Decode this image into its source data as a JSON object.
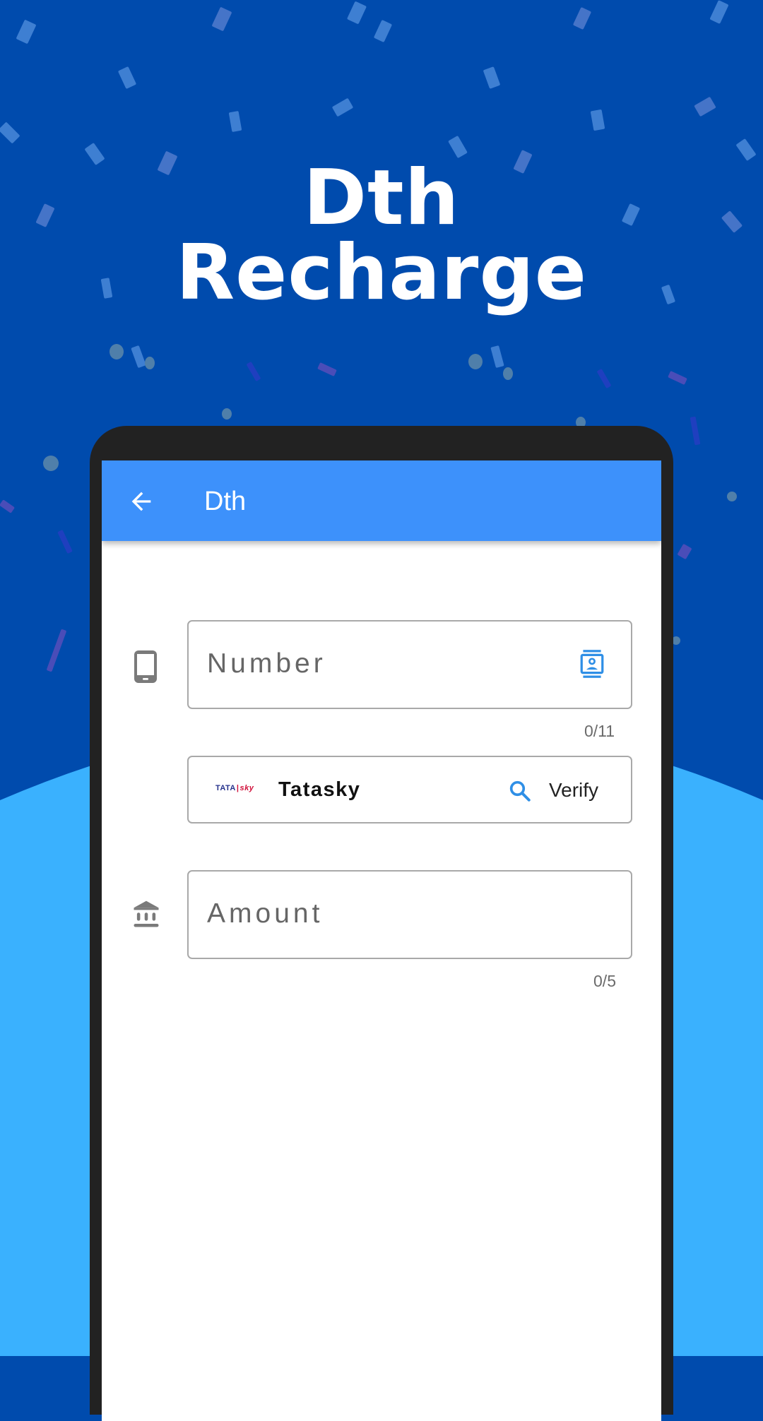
{
  "hero": {
    "title_line1": "Dth",
    "title_line2": "Recharge"
  },
  "colors": {
    "background_dark": "#004bad",
    "background_light": "#3ab1fe",
    "app_bar": "#3d91fb",
    "accent_icon": "#2f8fe6",
    "phone_bezel": "#222222"
  },
  "app_bar": {
    "back_icon": "arrow-left-icon",
    "title": "Dth"
  },
  "form": {
    "number_field": {
      "leading_icon": "smartphone-icon",
      "label": "Number",
      "trailing_icon": "contacts-icon",
      "value": "",
      "counter": "0/11"
    },
    "operator_field": {
      "logo_text_tata": "TATA",
      "logo_text_sky": "sky",
      "operator_name": "Tatasky",
      "verify_icon": "search-icon",
      "verify_label": "Verify"
    },
    "amount_field": {
      "leading_icon": "bank-icon",
      "label": "Amount",
      "value": "",
      "counter": "0/5"
    }
  }
}
